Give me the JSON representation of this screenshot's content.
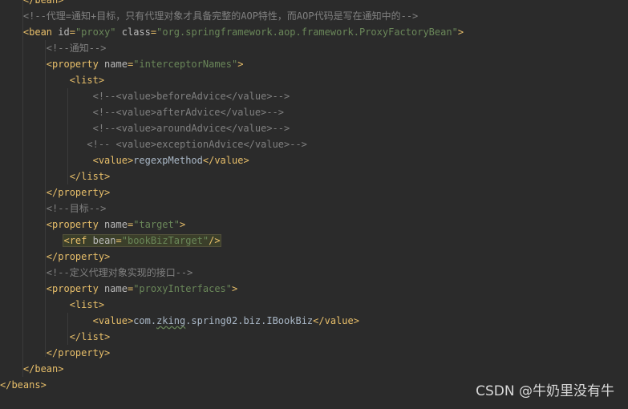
{
  "lines": [
    "    </bean>",
    "    <!--代理=通知+目标，只有代理对象才具备完整的AOP特性，而AOP代码是写在通知中的-->",
    "    <bean id=\"proxy\" class=\"org.springframework.aop.framework.ProxyFactoryBean\">",
    "        <!--通知-->",
    "        <property name=\"interceptorNames\">",
    "            <list>",
    "                <!--<value>beforeAdvice</value>-->",
    "                <!--<value>afterAdvice</value>-->",
    "                <!--<value>aroundAdvice</value>-->",
    "               <!-- <value>exceptionAdvice</value>-->",
    "                <value>regexpMethod</value>",
    "            </list>",
    "        </property>",
    "        <!--目标-->",
    "        <property name=\"target\">",
    "           <ref bean=\"bookBizTarget\"/>",
    "        </property>",
    "        <!--定义代理对象实现的接口-->",
    "        <property name=\"proxyInterfaces\">",
    "            <list>",
    "                <value>com.zking.spring02.biz.IBookBiz</value>",
    "            </list>",
    "        </property>",
    "    </bean>",
    "</beans>"
  ],
  "watermark": "CSDN @牛奶里没有牛",
  "colors": {
    "background": "#2b2b2b",
    "comment": "#808080",
    "tag": "#e8bf6a",
    "attribute": "#bababa",
    "value": "#6a8759",
    "text": "#a9b7c6"
  }
}
